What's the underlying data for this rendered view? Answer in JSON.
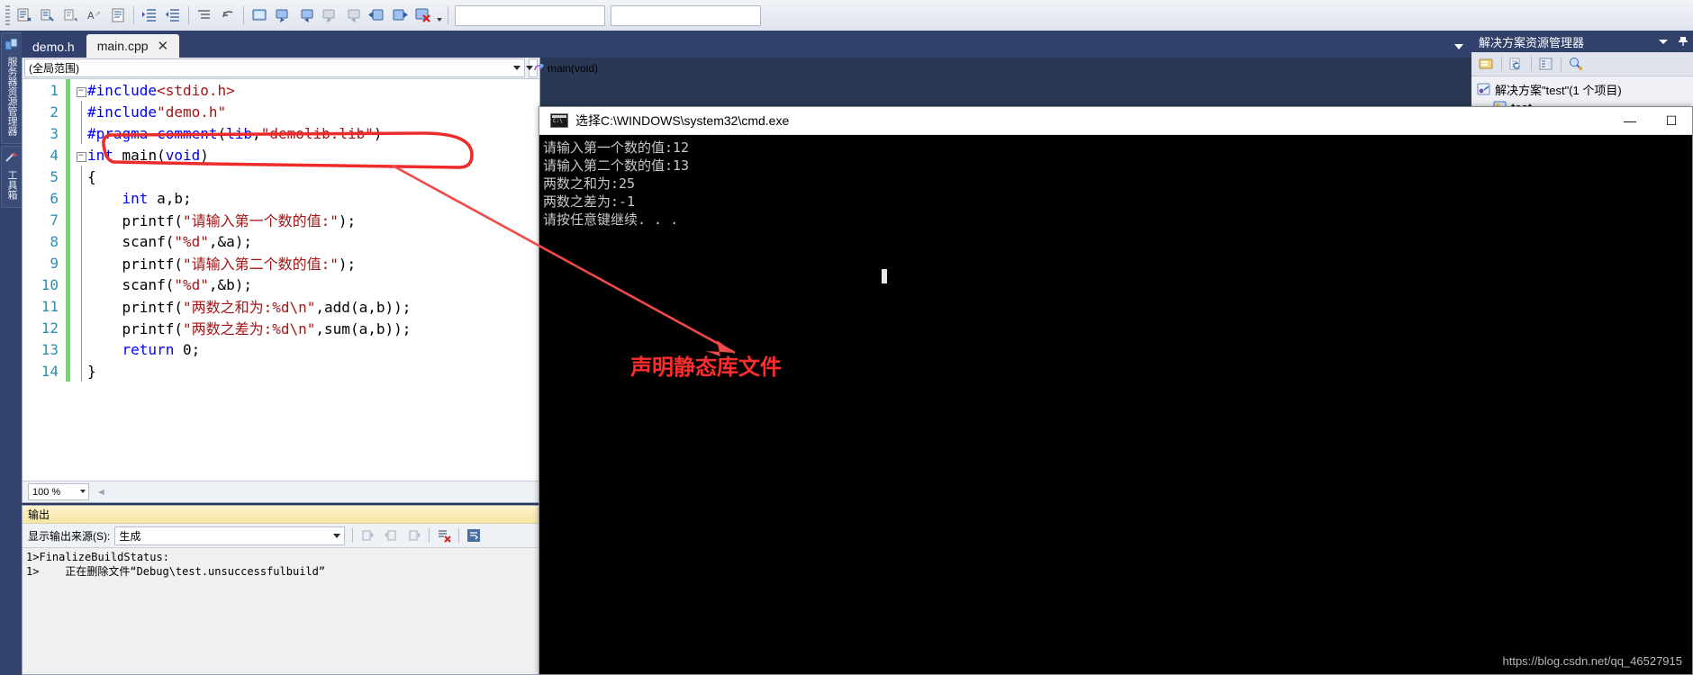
{
  "toolbar": {
    "buttons": [
      {
        "name": "comment-selection-icon"
      },
      {
        "name": "uncomment-selection-icon"
      },
      {
        "name": "navigate-backward-icon"
      },
      {
        "name": "toggle-word-wrap-icon"
      },
      {
        "name": "display-whitespace-icon"
      },
      {
        "name": "increase-indent-icon"
      },
      {
        "name": "decrease-indent-icon"
      },
      {
        "name": "collapse-definitions-icon"
      },
      {
        "name": "undo-last-navigation-icon"
      },
      {
        "name": "toggle-bookmark-icon"
      },
      {
        "name": "previous-bookmark-icon"
      },
      {
        "name": "next-bookmark-icon"
      },
      {
        "name": "previous-bookmark-in-folder-icon"
      },
      {
        "name": "next-bookmark-in-folder-icon"
      },
      {
        "name": "previous-bookmark-in-document-icon"
      },
      {
        "name": "next-bookmark-in-document-icon"
      },
      {
        "name": "clear-bookmarks-icon"
      }
    ],
    "overflow_label": "▾"
  },
  "leftbar": {
    "tabs": [
      {
        "label": "服务器资源管理器",
        "icon": "server-explorer-icon"
      },
      {
        "label": "工具箱",
        "icon": "toolbox-icon"
      }
    ]
  },
  "tabstrip": {
    "tabs": [
      {
        "label": "demo.h",
        "active": false,
        "close": ""
      },
      {
        "label": "main.cpp",
        "active": true,
        "close": "✕"
      }
    ]
  },
  "editor": {
    "scope_combo": "(全局范围)",
    "member_combo": "main(void)",
    "member_icon": "method-icon",
    "zoom_level": "100 %",
    "lines": [
      {
        "num": "1",
        "fold": "minus",
        "changed": true,
        "tokens": [
          {
            "t": "#include",
            "c": "pp"
          },
          {
            "t": "<stdio.h>",
            "c": "ang"
          }
        ]
      },
      {
        "num": "2",
        "fold": "bar",
        "changed": true,
        "tokens": [
          {
            "t": "#include",
            "c": "pp"
          },
          {
            "t": "\"demo.h\"",
            "c": "str"
          }
        ]
      },
      {
        "num": "3",
        "fold": "bar",
        "changed": true,
        "tokens": [
          {
            "t": "#pragma ",
            "c": "pp"
          },
          {
            "t": "comment",
            "c": "pp"
          },
          {
            "t": "(",
            "c": "plain"
          },
          {
            "t": "lib",
            "c": "pp"
          },
          {
            "t": ",",
            "c": "plain"
          },
          {
            "t": "\"demolib.lib\"",
            "c": "str"
          },
          {
            "t": ")",
            "c": "plain"
          }
        ]
      },
      {
        "num": "4",
        "fold": "minus",
        "changed": true,
        "tokens": [
          {
            "t": "int",
            "c": "kw"
          },
          {
            "t": " main(",
            "c": "plain"
          },
          {
            "t": "void",
            "c": "kw"
          },
          {
            "t": ")",
            "c": "plain"
          }
        ]
      },
      {
        "num": "5",
        "fold": "bar",
        "changed": true,
        "tokens": [
          {
            "t": "{",
            "c": "plain"
          }
        ]
      },
      {
        "num": "6",
        "fold": "bar",
        "changed": true,
        "tokens": [
          {
            "t": "    ",
            "c": "plain"
          },
          {
            "t": "int",
            "c": "kw"
          },
          {
            "t": " a,b;",
            "c": "plain"
          }
        ]
      },
      {
        "num": "7",
        "fold": "bar",
        "changed": true,
        "tokens": [
          {
            "t": "    printf(",
            "c": "plain"
          },
          {
            "t": "\"请输入第一个数的值:\"",
            "c": "str"
          },
          {
            "t": ");",
            "c": "plain"
          }
        ]
      },
      {
        "num": "8",
        "fold": "bar",
        "changed": true,
        "tokens": [
          {
            "t": "    scanf(",
            "c": "plain"
          },
          {
            "t": "\"%d\"",
            "c": "str"
          },
          {
            "t": ",&a);",
            "c": "plain"
          }
        ]
      },
      {
        "num": "9",
        "fold": "bar",
        "changed": true,
        "tokens": [
          {
            "t": "    printf(",
            "c": "plain"
          },
          {
            "t": "\"请输入第二个数的值:\"",
            "c": "str"
          },
          {
            "t": ");",
            "c": "plain"
          }
        ]
      },
      {
        "num": "10",
        "fold": "bar",
        "changed": true,
        "tokens": [
          {
            "t": "    scanf(",
            "c": "plain"
          },
          {
            "t": "\"%d\"",
            "c": "str"
          },
          {
            "t": ",&b);",
            "c": "plain"
          }
        ]
      },
      {
        "num": "11",
        "fold": "bar",
        "changed": true,
        "tokens": [
          {
            "t": "    printf(",
            "c": "plain"
          },
          {
            "t": "\"两数之和为:%d\\n\"",
            "c": "str"
          },
          {
            "t": ",add(a,b));",
            "c": "plain"
          }
        ]
      },
      {
        "num": "12",
        "fold": "bar",
        "changed": true,
        "tokens": [
          {
            "t": "    printf(",
            "c": "plain"
          },
          {
            "t": "\"两数之差为:%d\\n\"",
            "c": "str"
          },
          {
            "t": ",sum(a,b));",
            "c": "plain"
          }
        ]
      },
      {
        "num": "13",
        "fold": "bar",
        "changed": true,
        "tokens": [
          {
            "t": "    ",
            "c": "plain"
          },
          {
            "t": "return",
            "c": "kw"
          },
          {
            "t": " 0;",
            "c": "plain"
          }
        ]
      },
      {
        "num": "14",
        "fold": "bar",
        "changed": true,
        "tokens": [
          {
            "t": "}",
            "c": "plain"
          }
        ]
      }
    ]
  },
  "output_pane": {
    "title": "输出",
    "source_label": "显示输出来源(S):",
    "source_value": "生成",
    "toolbar_icons": [
      "jump-to-previous-message-icon",
      "jump-to-next-message-icon",
      "go-to-next-message-icon",
      "clear-all-icon",
      "toggle-word-wrap-icon"
    ],
    "text": "1>FinalizeBuildStatus:\n1>    正在删除文件“Debug\\test.unsuccessfulbuild”"
  },
  "solution_explorer": {
    "title": "解决方案资源管理器",
    "dropdown_icon": "chevron-down-icon",
    "pin_icon": "pin-icon",
    "toolbar_icons": [
      "home-icon",
      "refresh-icon",
      "show-all-files-icon",
      "properties-icon",
      "preview-selected-items-icon"
    ],
    "tree": [
      {
        "label": "解决方案\"test\"(1 个项目)",
        "icon": "solution-icon",
        "indent": 0
      },
      {
        "label": "test",
        "icon": "project-icon",
        "indent": 1
      }
    ]
  },
  "console": {
    "title": "选择C:\\WINDOWS\\system32\\cmd.exe",
    "icon": "cmd-icon",
    "minimize_label": "—",
    "maximize_label": "☐",
    "lines": [
      "请输入第一个数的值:12",
      "请输入第二个数的值:13",
      "两数之和为:25",
      "两数之差为:-1",
      "请按任意键继续. . ."
    ]
  },
  "annotations": {
    "callout_text": "声明静态库文件",
    "callout_color": "#ff2d2d"
  },
  "watermark": {
    "text": "https://blog.csdn.net/qq_46527915"
  },
  "colors": {
    "chrome": "#31416b",
    "accent_red": "#ff2d2d",
    "keyword_blue": "#0000ff",
    "string_red": "#a31515",
    "line_number": "#2b91af",
    "changed_bar_green": "#6dda6d"
  }
}
